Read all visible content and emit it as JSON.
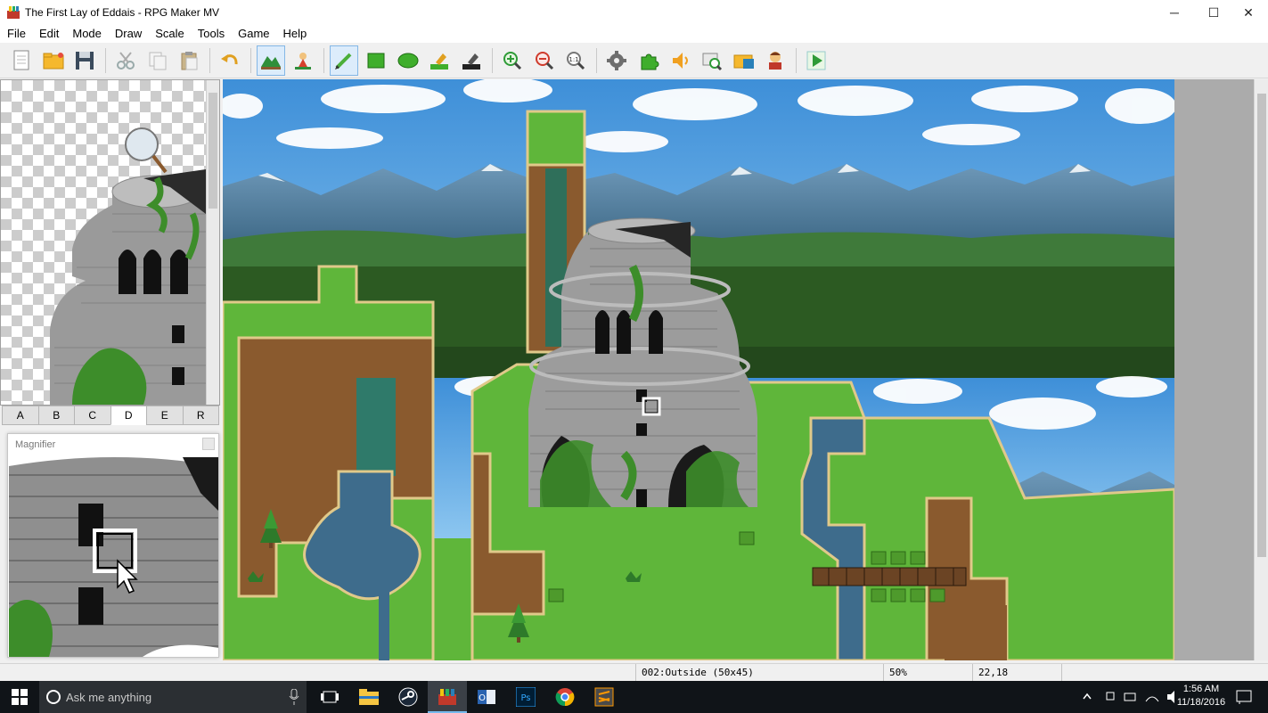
{
  "window": {
    "title": "The First Lay of Eddais - RPG Maker MV",
    "minimize_glyph": "─",
    "maximize_glyph": "☐",
    "close_glyph": "✕"
  },
  "menu": [
    "File",
    "Edit",
    "Mode",
    "Draw",
    "Scale",
    "Tools",
    "Game",
    "Help"
  ],
  "toolbar": {
    "icons": [
      "new-project-icon",
      "open-project-icon",
      "save-project-icon",
      "cut-icon",
      "copy-icon",
      "paste-icon",
      "undo-icon",
      "map-mode-icon",
      "event-mode-icon",
      "pencil-icon",
      "rectangle-icon",
      "ellipse-icon",
      "fill-icon",
      "shadow-pen-icon",
      "zoom-in-icon",
      "zoom-out-icon",
      "actual-size-icon",
      "database-icon",
      "plugin-manager-icon",
      "sound-test-icon",
      "event-searcher-icon",
      "resource-manager-icon",
      "character-generator-icon",
      "playtest-icon"
    ],
    "zoom_actual_label": "1:1"
  },
  "tileset_tabs": [
    "A",
    "B",
    "C",
    "D",
    "E",
    "R"
  ],
  "tileset_active_tab": "D",
  "magnifier": {
    "title": "Magnifier"
  },
  "status": {
    "map": "002:Outside (50x45)",
    "zoom": "50%",
    "coords": "22,18"
  },
  "taskbar": {
    "search_placeholder": "Ask me anything",
    "time": "1:56 AM",
    "date": "11/18/2016",
    "apps": [
      "task-view-icon",
      "file-explorer-icon",
      "steam-icon",
      "rpg-maker-icon",
      "outlook-icon",
      "photoshop-icon",
      "chrome-icon",
      "sublime-icon"
    ],
    "photoshop_label": "Ps"
  },
  "colors": {
    "accent": "#76b9ed",
    "grass": "#5fb63a",
    "water": "#3e6c8c",
    "cliff": "#8a5a2e",
    "sky": "#4d9fe0",
    "mountain": "#3f6b8e"
  }
}
